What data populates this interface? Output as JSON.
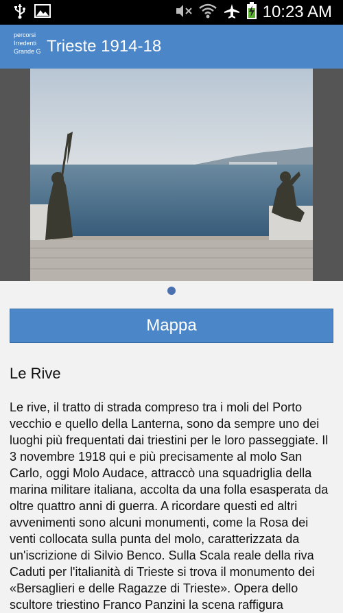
{
  "status_bar": {
    "time": "10:23 AM",
    "icons": [
      "usb-icon",
      "image-icon",
      "mute-icon",
      "wifi-icon",
      "airplane-icon",
      "battery-charging-icon"
    ]
  },
  "app_bar": {
    "logo_lines": [
      "percorsi",
      "Irredenti",
      "Grande G"
    ],
    "title": "Trieste 1914-18"
  },
  "gallery": {
    "image_description": "Statues on the waterfront in Trieste",
    "page_indicator_count": 1,
    "active_index": 0
  },
  "map_button": {
    "label": "Mappa"
  },
  "section": {
    "title": "Le Rive",
    "body": "Le rive, il tratto di strada compreso tra i moli del Porto vecchio e quello  della Lanterna, sono da sempre uno dei luoghi più frequentati dai triestini per le loro passeggiate. Il 3 novembre 1918 qui e più precisamente al molo San Carlo, oggi Molo Audace, attraccò una squadriglia della marina militare italiana, accolta da una folla esasperata da oltre quattro anni di guerra. A ricordare questi ed altri avvenimenti sono alcuni monumenti, come la Rosa dei venti collocata sulla punta del molo, caratterizzata da un'iscrizione di Silvio Benco. Sulla Scala reale della riva Caduti per l'italianità di Trieste si trova il monumento dei «Bersaglieri e delle Ragazze di Trieste». Opera dello scultore triestino Franco Panzini la scena raffigura"
  },
  "colors": {
    "accent": "#4a86c8",
    "status_bar_bg": "#000000",
    "page_bg": "#f2f2f2",
    "dot": "#4a70b0"
  }
}
